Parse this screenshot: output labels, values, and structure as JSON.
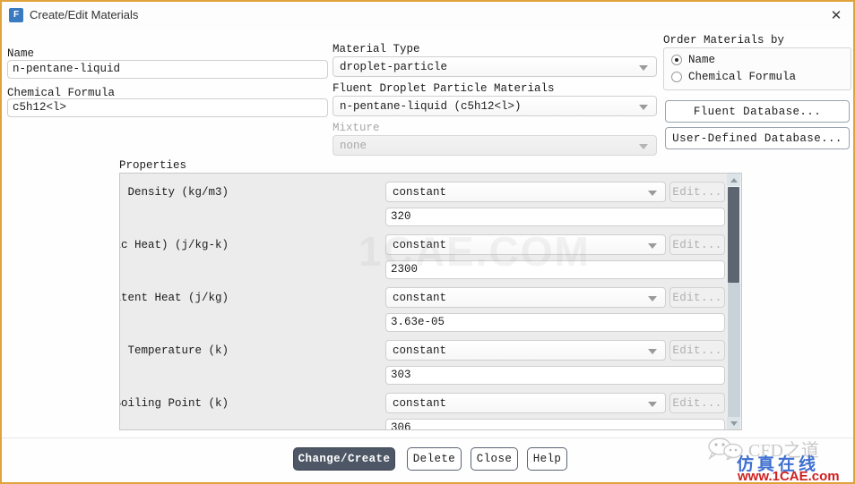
{
  "window": {
    "title": "Create/Edit Materials",
    "icon": "fluent-app-icon",
    "icon_letter": "F",
    "close_label": "✕",
    "border_color": "#e0a33c"
  },
  "left": {
    "name_label": "Name",
    "name_value": "n-pentane-liquid",
    "formula_label": "Chemical Formula",
    "formula_value": "c5h12<l>"
  },
  "middle": {
    "material_type_label": "Material Type",
    "material_type_value": "droplet-particle",
    "fluent_materials_label": "Fluent Droplet Particle Materials",
    "fluent_materials_value": "n-pentane-liquid (c5h12<l>)",
    "mixture_label": "Mixture",
    "mixture_value": "none"
  },
  "order_by": {
    "title": "Order Materials by",
    "options": [
      {
        "label": "Name",
        "selected": true
      },
      {
        "label": "Chemical Formula",
        "selected": false
      }
    ],
    "fluent_database_button": "Fluent Database...",
    "user_database_button": "User-Defined Database..."
  },
  "properties": {
    "title": "Properties",
    "edit_label": "Edit...",
    "rows": [
      {
        "label": "Density (kg/m3)",
        "method": "constant",
        "value": "320"
      },
      {
        "label": "Cp (Specific Heat) (j/kg-k)",
        "method": "constant",
        "value": "2300"
      },
      {
        "label": "Latent Heat (j/kg)",
        "method": "constant",
        "value": "3.63e-05"
      },
      {
        "label": "Vaporization Temperature (k)",
        "method": "constant",
        "value": "303"
      },
      {
        "label": "Boiling Point (k)",
        "method": "constant",
        "value": "306"
      }
    ]
  },
  "footer": {
    "change_create": "Change/Create",
    "delete": "Delete",
    "close": "Close",
    "help": "Help"
  },
  "watermark": {
    "center": "1CAE.COM",
    "brand_cn": "CFD之道",
    "brand_sub": "仿真在线",
    "brand_url": "www.1CAE.com"
  }
}
